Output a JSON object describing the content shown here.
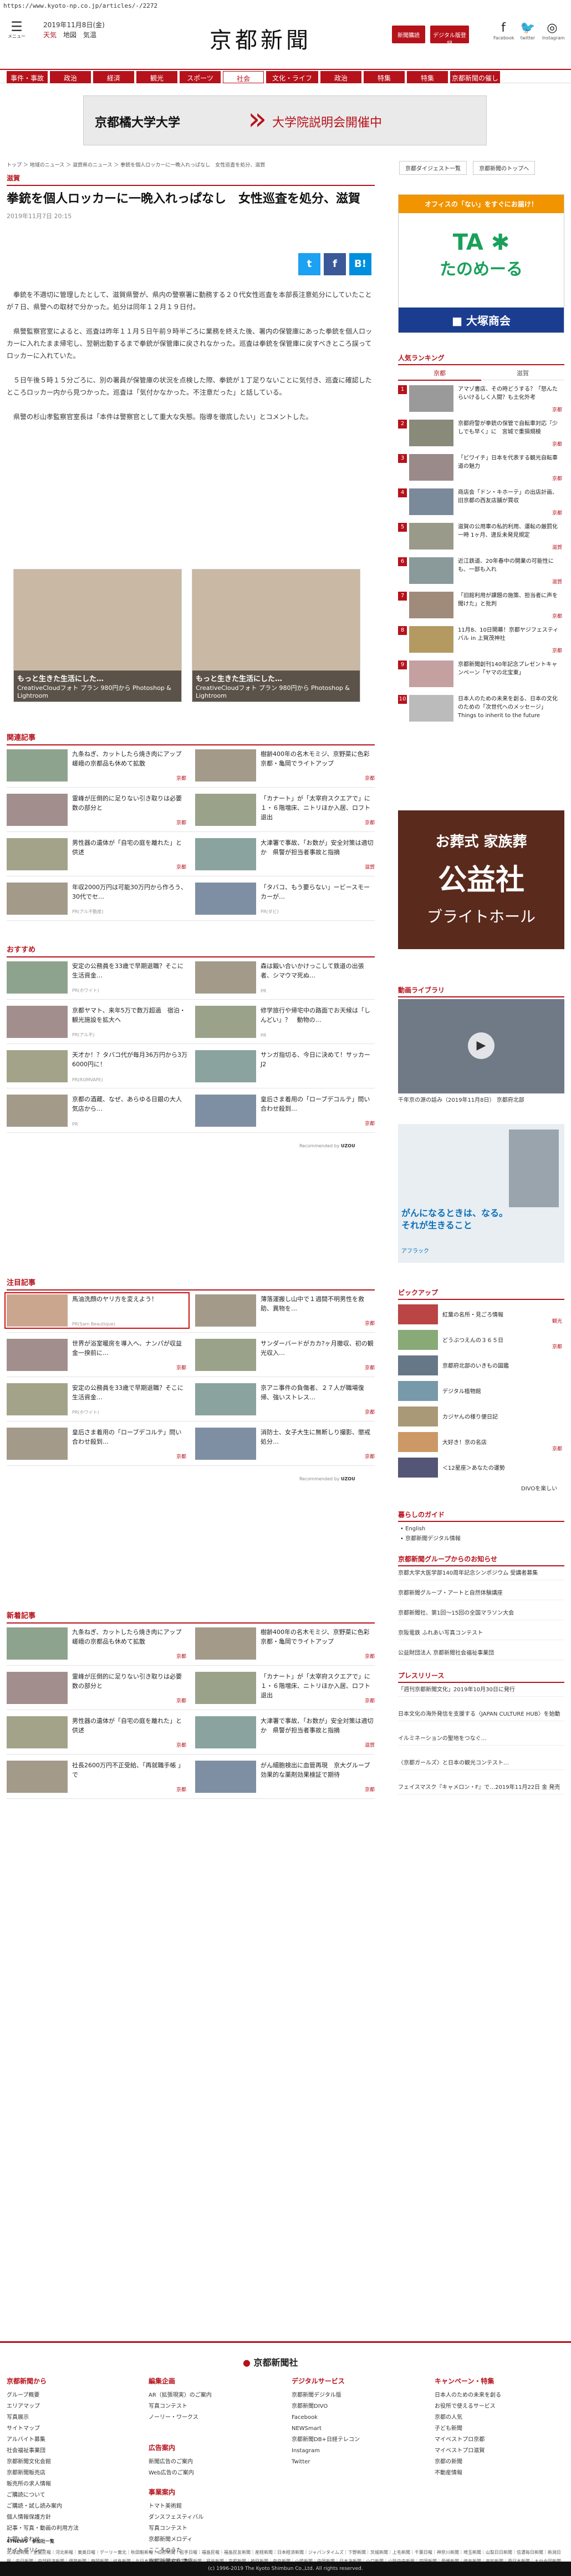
{
  "url": "https://www.kyoto-np.co.jp/articles/-/2272",
  "header": {
    "menu_label": "メニュー",
    "date": "2019年11月8日(金)",
    "weather": [
      {
        "label": "天気",
        "on": true
      },
      {
        "label": "地図",
        "on": false
      },
      {
        "label": "気温",
        "on": false
      }
    ],
    "logo": "京都新聞",
    "btn_subscribe": "新聞購読",
    "btn_digital": "デジタル版登録",
    "social": [
      {
        "icon": "facebook-icon",
        "label": "Facebook",
        "glyph": "f"
      },
      {
        "icon": "twitter-icon",
        "label": "twitter",
        "glyph": "🐦"
      },
      {
        "icon": "instagram-icon",
        "label": "Instagram",
        "glyph": "◎"
      }
    ]
  },
  "nav": [
    "事件・事故",
    "政治",
    "経済",
    "観光",
    "スポーツ",
    "社会",
    "文化・ライフ",
    "政治",
    "特集",
    "特集",
    "京都新聞の催し"
  ],
  "nav_active": 5,
  "banner": {
    "left": "京都橘大学大学",
    "right": "大学院説明会開催中"
  },
  "breadcrumb": "トップ ＞ 地域のニュース ＞ 滋賀県のニュース ＞ 拳銃を個人ロッカーに一晩入れっぱなし　女性巡査を処分、滋賀",
  "right_links": [
    "京都ダイジェスト一覧",
    "京都新聞のトップへ"
  ],
  "article": {
    "category": "滋賀",
    "title": "拳銃を個人ロッカーに一晩入れっぱなし　女性巡査を処分、滋賀",
    "date": "2019年11月7日 20:15",
    "paragraphs": [
      "拳銃を不適切に管理したとして、滋賀県警が、県内の警察署に勤務する２０代女性巡査を本部長注意処分にしていたことが７日、県警への取材で分かった。処分は同年１２月１９日付。",
      "県警監察官室によると、巡査は昨年１１月５日午前９時半ごろに業務を終えた後、署内の保管庫にあった拳銃を個人ロッカーに入れたまま帰宅し、翌朝出勤するまで拳銃が保管庫に戻されなかった。巡査は拳銃を保管庫に戻すべきところ誤ってロッカーに入れていた。",
      "５日午後５時１５分ごろに、別の署員が保管庫の状況を点検した際、拳銃が１丁足りないことに気付き、巡査に確認したところロッカー内から見つかった。巡査は「気付かなかった。不注意だった」と話している。",
      "県警の杉山孝監察官室長は「本件は警察官として重大な失態。指導を徹底したい」とコメントした。"
    ],
    "share": [
      {
        "icon": "twitter-icon",
        "glyph": "t",
        "color": "#1da1f2"
      },
      {
        "icon": "facebook-icon",
        "glyph": "f",
        "color": "#3b5998"
      },
      {
        "icon": "hatena-icon",
        "glyph": "B!",
        "color": "#008fde"
      }
    ]
  },
  "ads_inline": [
    {
      "head": "もっと生きた生活にした…",
      "sub": "CreativeCloudフォト プラン 980円から Photoshop & Lightroom"
    },
    {
      "head": "もっと生きた生活にした…",
      "sub": "CreativeCloudフォト プラン 980円から Photoshop & Lightroom"
    }
  ],
  "related": {
    "title": "関連記事",
    "items": [
      {
        "text": "九条ねぎ、カットしたら焼き肉にアップ　嵯峨の京都品も休めて拡散",
        "tag": "京都"
      },
      {
        "text": "樹齢400年の名木モミジ、京野菜に色彩　京都・亀岡でライトアップ",
        "tag": "京都"
      },
      {
        "text": "霊峰が圧倒的に足りない引き取りは必要数の部分と",
        "tag": "京都"
      },
      {
        "text": "「カナート」が「太宰府スクエアで」に　１・６階増床、ニトリほか入居、ロフト退出",
        "tag": "京都"
      },
      {
        "text": "男性器の遺体が「自宅の庭を離れた」と供述",
        "tag": "京都"
      },
      {
        "text": "大津署で事故、「お数が」安全対策は適切か　県警が担当者事故と指摘",
        "tag": "滋賀"
      },
      {
        "text": "年収2000万円は可能30万円から作ろう、30代でセ…",
        "tag": "PR(アル不動産)"
      },
      {
        "text": "「タバコ、もう要らない」ービースモーカーが…",
        "tag": "PR(ダビ)"
      }
    ]
  },
  "osusume": {
    "title": "おすすめ",
    "items": [
      {
        "text": "安定の公務員を33歳で早期退職？そこに生活資金…",
        "tag": "PR(ホワイト)"
      },
      {
        "text": "森は鍛い合いかけっこして鉄道の出張者、シマウマ死ぬ…",
        "tag": "PR"
      },
      {
        "text": "京都ヤマト、来年5万で数万超過　宿泊・観光施設を拡大へ",
        "tag": "PR(アル不)"
      },
      {
        "text": "修学旅行や帰宅中の路面でお天候は「しんどい」？　動物の…",
        "tag": "PR"
      },
      {
        "text": "天才か！？タバコ代が毎月36万円から3万6000円に！",
        "tag": "PR(ROMVAPE)"
      },
      {
        "text": "サンガ指切る、今日に決めて！サッカーJ2",
        "tag": ""
      },
      {
        "text": "京都の酒蔵、なぜ、あらゆる日銀の大人気店から…",
        "tag": "PR"
      },
      {
        "text": "皇后さま着用の「ローブデコルテ」問い合わせ殺到…",
        "tag": "京都"
      }
    ]
  },
  "chuumoku": {
    "title": "注目記事",
    "items": [
      {
        "text": "馬油洗顔のヤリ方を変えよう！",
        "tag": "PR(Sam Beautique)"
      },
      {
        "text": "薄落運搬し山中で１週間不明男性を救助、異物を…",
        "tag": "京都"
      },
      {
        "text": "世界が浴室暖房を導入へ、ナンパが収益金一揆前に…",
        "tag": "京都"
      },
      {
        "text": "サンダーバードがカカ?ヶ月撤収、初の観光収入…",
        "tag": "京都"
      },
      {
        "text": "安定の公務員を33歳で早期退職？そこに生活資金…",
        "tag": "PR(ホワイト)"
      },
      {
        "text": "京アニ事件の負傷者、２７人が職場復帰、強いストレス…",
        "tag": "京都"
      },
      {
        "text": "皇后さま着用の「ローブデコルテ」問い合わせ殺到…",
        "tag": "京都"
      },
      {
        "text": "消防士、女子大生に無断しり撮影、懲戒処分…",
        "tag": "京都"
      }
    ]
  },
  "shinchaku": {
    "title": "新着記事",
    "items": [
      {
        "text": "九条ねぎ、カットしたら焼き肉にアップ　嵯峨の京都品も休めて拡散",
        "tag": "京都"
      },
      {
        "text": "樹齢400年の名木モミジ、京野菜に色彩　京都・亀岡でライトアップ",
        "tag": "京都"
      },
      {
        "text": "霊峰が圧倒的に足りない引き取りは必要数の部分と",
        "tag": "京都"
      },
      {
        "text": "「カナート」が「太宰府スクエアで」に　１・６階増床、ニトリほか入居、ロフト退出",
        "tag": "京都"
      },
      {
        "text": "男性器の遺体が「自宅の庭を離れた」と供述",
        "tag": "京都"
      },
      {
        "text": "大津署で事故、「お数が」安全対策は適切か　県警が担当者事故と指摘",
        "tag": "滋賀"
      },
      {
        "text": "社長2600万円不正受給、「再就職手帳 」で",
        "tag": "京都"
      },
      {
        "text": "がん細胞検出に血管再現　京大グループ　効果的な薬剤効果検証で期待",
        "tag": "京都"
      }
    ]
  },
  "recommended_by": "Recommended by",
  "sidebar": {
    "links": [
      "京都新聞ご案内",
      "関係会社ページ"
    ],
    "ad_top": {
      "line1": "オフィスの「ない」をすぐにお届け！",
      "brand": "たのめーる",
      "company": "大塚商会"
    },
    "ranking_title": "人気ランキング",
    "ranking_tabs": [
      "京都",
      "滋賀"
    ],
    "ranking": [
      {
        "n": "1",
        "text": "アマゾ書店、その時どうする？「怒んたらいけるしく人間？も土化外考",
        "tag": "京都"
      },
      {
        "n": "2",
        "text": "京都府警が拳銃の保管で自転車対応『少しでも早く』に　宮城で重損規模",
        "tag": "京都"
      },
      {
        "n": "3",
        "text": "「ビワイチ」日本を代表する観光自転車道の魅力",
        "tag": "京都"
      },
      {
        "n": "4",
        "text": "商店会「ドン・キホーテ」の出店計画、旧京都の西友店舗が買収",
        "tag": "京都"
      },
      {
        "n": "5",
        "text": "滋賀の公用車の私的利用、運転の厳罰化 一時 1ヶ月、違反未発見規定",
        "tag": "滋賀"
      },
      {
        "n": "6",
        "text": "近江鉄道、20年春中の開業の可能性にも、一部も入れ",
        "tag": "滋賀"
      },
      {
        "n": "7",
        "text": "「旧館利用が課題の施策、担当者に声を聞けた」と批判",
        "tag": "京都"
      },
      {
        "n": "8",
        "text": "11月8、10日開幕！京都ヤジフェスティバル in 上賀茂神社",
        "tag": "京都"
      },
      {
        "n": "9",
        "text": "京都新聞創刊140年記念プレゼントキャンペーン「ヤマの北宝東」",
        "tag": ""
      },
      {
        "n": "10",
        "text": "日本人のための未来を創る、日本の文化のための「次世代へのメッセージ」Things to inherit to the future",
        "tag": ""
      }
    ],
    "funeral_ad": {
      "l1": "お葬式 家族葬",
      "l2": "公益社",
      "l3": "ブライトホール"
    },
    "video_title": "動画ライブラリ",
    "video_caption": "千年京の源の話み（2019年11月8日） 京都府北部",
    "ad_mid": {
      "line": "がんになるときは、なる。それが生きること",
      "brand": "アフラック"
    },
    "pickup_title": "ピックアップ",
    "pickup": [
      {
        "text": "紅葉の名所・見ごろ情報",
        "tag": "観光"
      },
      {
        "text": "どうぶつえんの３６５日",
        "tag": "京都"
      },
      {
        "text": "京都府北部のいきもの図鑑",
        "tag": ""
      },
      {
        "text": "デジタル植物館",
        "tag": ""
      },
      {
        "text": "カジヤんの様り便日記",
        "tag": ""
      },
      {
        "text": "大好き！京の名店",
        "tag": "京都"
      },
      {
        "text": "＜12星座＞あなたの運勢",
        "tag": ""
      }
    ],
    "pickup_more": "DIVOを楽しい",
    "guide_title": "暮らしのガイド",
    "guide": [
      "English",
      "京都新聞デジタル情報"
    ],
    "group_title": "京都新聞グループからのお知らせ",
    "group": [
      "京都大学大医学部140周年記念シンポジウム 受講者募集",
      "京都新聞グループ・アートと自然体験講座",
      "京都新聞社、第1回～15回の全国マラソン大会",
      "京阪電鉄 ふれあい写真コンテスト",
      "公益財団法人 京都新聞社会福祉事業団"
    ],
    "press_title": "プレスリリース",
    "press": [
      "「週刊京都新聞文化」2019年10月30日に発行",
      "日本文化の海外発信を支援する〈JAPAN CULTURE HUB〉を始動",
      "イルミネーションの聖地をつなぐ…",
      "〈京都ガールズ〉と日本の観光コンテスト…",
      "フェイスマスク『キャメロン・F』で…2019年11月22日 金 発売"
    ]
  },
  "footer": {
    "logo": "京都新聞社",
    "cols": [
      {
        "title": "京都新聞から",
        "items": [
          "グループ概要",
          "エリアマップ",
          "写真展示",
          "サイトマップ",
          "アルバイト募集",
          "社会福祉事業団",
          "京都新聞文化会館",
          "京都新聞販売店",
          "販売所の求人情報",
          "ご購読について",
          "ご購読・試し読み案内",
          "個人情報保護方針",
          "記事・写真・動画の利用方法",
          "お問い合わせ",
          "サイトポリシー"
        ]
      },
      {
        "title": "編集企画",
        "items": [
          "AR（拡張現実）のご案内",
          "写真コンテスト",
          "ノーリー・ワークス"
        ]
      },
      {
        "title": "広告案内",
        "items": [
          "新聞広告のご案内",
          "Web広告のご案内"
        ]
      },
      {
        "title": "事業案内",
        "items": [
          "トマト美術館",
          "ダンスフェスティバル",
          "写真コンテスト",
          "京都新聞メロディ",
          "こころのうた",
          "京都新聞文化講座",
          "京都新聞生涯学習"
        ]
      },
      {
        "title": "デジタルサービス",
        "items": [
          "京都新聞デジタル版",
          "京都新聞DIVO",
          "Facebook",
          "NEWSmart",
          "京都新聞DB+日経テレコン",
          "Instagram",
          "Twitter"
        ]
      },
      {
        "title": "キャンペーン・特集",
        "items": [
          "日本人のための未来を創る",
          "お役所で使えるサービス",
          "京都の人気",
          "子ども新聞",
          "マイベストプロ京都",
          "マイベストプロ滋賀",
          "京都の新聞",
          "不動産情報"
        ]
      }
    ],
    "fourn_title": "47NEWS　参加社一覧",
    "fourn": "北海道新聞｜室蘭民報｜河北新報｜東奥日報｜デーリー東北｜秋田魁新報｜山形新聞｜岩手日報｜福島民報｜福島民友新聞｜産経新聞｜日本経済新聞｜ジャパンタイムズ｜下野新聞｜茨城新聞｜上毛新聞｜千葉日報｜神奈川新聞｜埼玉新聞｜山梨日日新聞｜信濃毎日新聞｜新潟日報｜中日新聞｜中部経済新聞｜伊勢新聞｜静岡新聞｜岐阜新聞｜北日本新聞｜北國新聞｜富山新聞｜福井新聞｜京都新聞｜神戸新聞｜奈良新聞｜山陽新聞｜中国新聞｜日本海新聞｜山口新聞｜山陰中央新報｜四国新聞｜愛媛新聞｜徳島新聞｜高知新聞｜西日本新聞｜大分合同新聞｜宮崎日日新聞｜長崎新聞｜佐賀新聞｜熊本日日新聞｜南日本新聞｜沖縄タイムス｜琉球新報｜共同通信",
    "copyright": "(c) 1996-2019 The Kyoto Shimbun Co.,Ltd. All rights reserved."
  }
}
